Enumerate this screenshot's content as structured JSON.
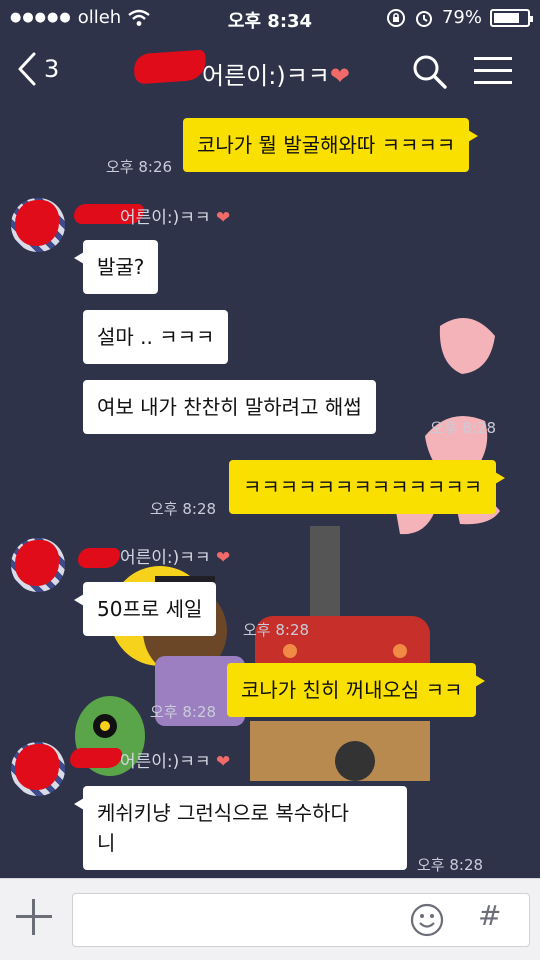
{
  "status_bar": {
    "signal": "●●●●●",
    "carrier": "olleh",
    "time": "오후 8:34",
    "battery_percent": "79%",
    "battery_level": 0.79
  },
  "nav": {
    "back_count": "3",
    "title": "어른이:)ㅋㅋ",
    "title_heart": "❤"
  },
  "messages": {
    "m0_time": "오후 8:26",
    "m0_text": "코나가 뭘 발굴해와따 ㅋㅋㅋㅋ",
    "sender_name": "어른이:)ㅋㅋ",
    "sender_heart": "❤",
    "m1_text": "발굴?",
    "m2_text": "설마 .. ㅋㅋㅋ",
    "m3_text": "여보 내가 찬찬히 말하려고 해썹",
    "m3_time": "오후 8:28",
    "m4_text": "ㅋㅋㅋㅋㅋㅋㅋㅋㅋㅋㅋㅋㅋ",
    "m4_time": "오후 8:28",
    "m5_text": "50프로 세일",
    "m5_time": "오후 8:28",
    "m6_text": "코나가 친히 꺼내오심 ㅋㅋ",
    "m6_time": "오후 8:28",
    "m7_text": "케쉬키냥 그런식으로 복수하다\n니",
    "m7_time": "오후 8:28"
  },
  "input_bar": {
    "plus_icon": "plus-icon",
    "emoji_icon": "emoji-icon",
    "hash_label": "#"
  },
  "colors": {
    "background": "#2e3349",
    "my_bubble": "#f9e000",
    "their_bubble": "#ffffff",
    "redaction": "#e00c1a"
  }
}
